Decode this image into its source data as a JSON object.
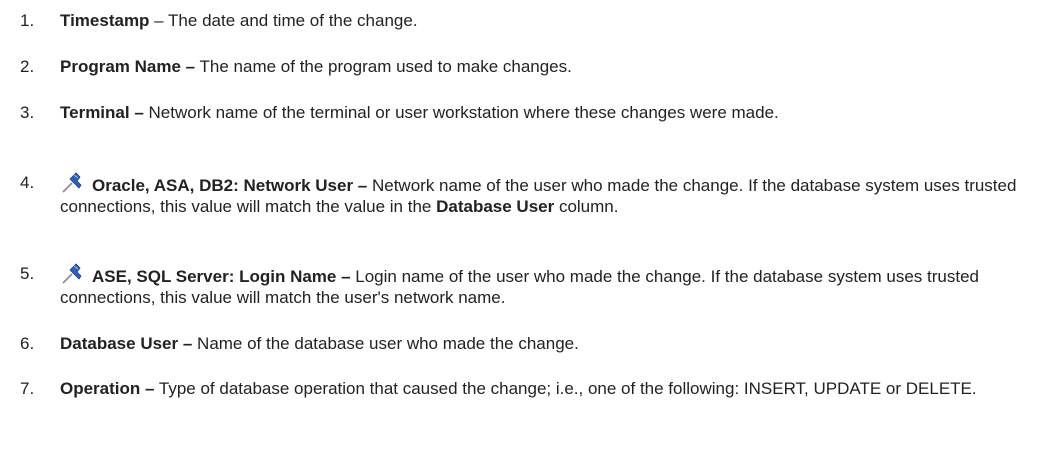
{
  "items": [
    {
      "number": "1.",
      "term": "Timestamp",
      "sep": " – ",
      "text": "The date and time of the change."
    },
    {
      "number": "2.",
      "term": "Program Name –",
      "text": " The name of the program used to make changes."
    },
    {
      "number": "3.",
      "term": "Terminal –",
      "text": " Network name of the terminal or user workstation where these changes were made."
    },
    {
      "number": "4.",
      "icon": "pushpin-icon",
      "term": "Oracle, ASA, DB2: Network User –",
      "text": " Network name of the user who made the change. If the database system uses trusted connections, this value will match the value in the ",
      "term2": "Database User",
      "text2": " column."
    },
    {
      "number": "5.",
      "icon": "pushpin-icon",
      "term": "ASE, SQL Server:  Login Name –",
      "text": " Login name of the user who made the change. If the database system uses trusted connections, this value will match the user's network name."
    },
    {
      "number": "6.",
      "term": "Database User –",
      "text": " Name of the database user who made the change."
    },
    {
      "number": "7.",
      "term": "Operation –",
      "text": " Type of database operation that caused the change; i.e., one of the following: INSERT, UPDATE or DELETE."
    }
  ],
  "icon_colors": {
    "pin_head": "#2f5fb8",
    "pin_needle": "#8a8a8a"
  }
}
